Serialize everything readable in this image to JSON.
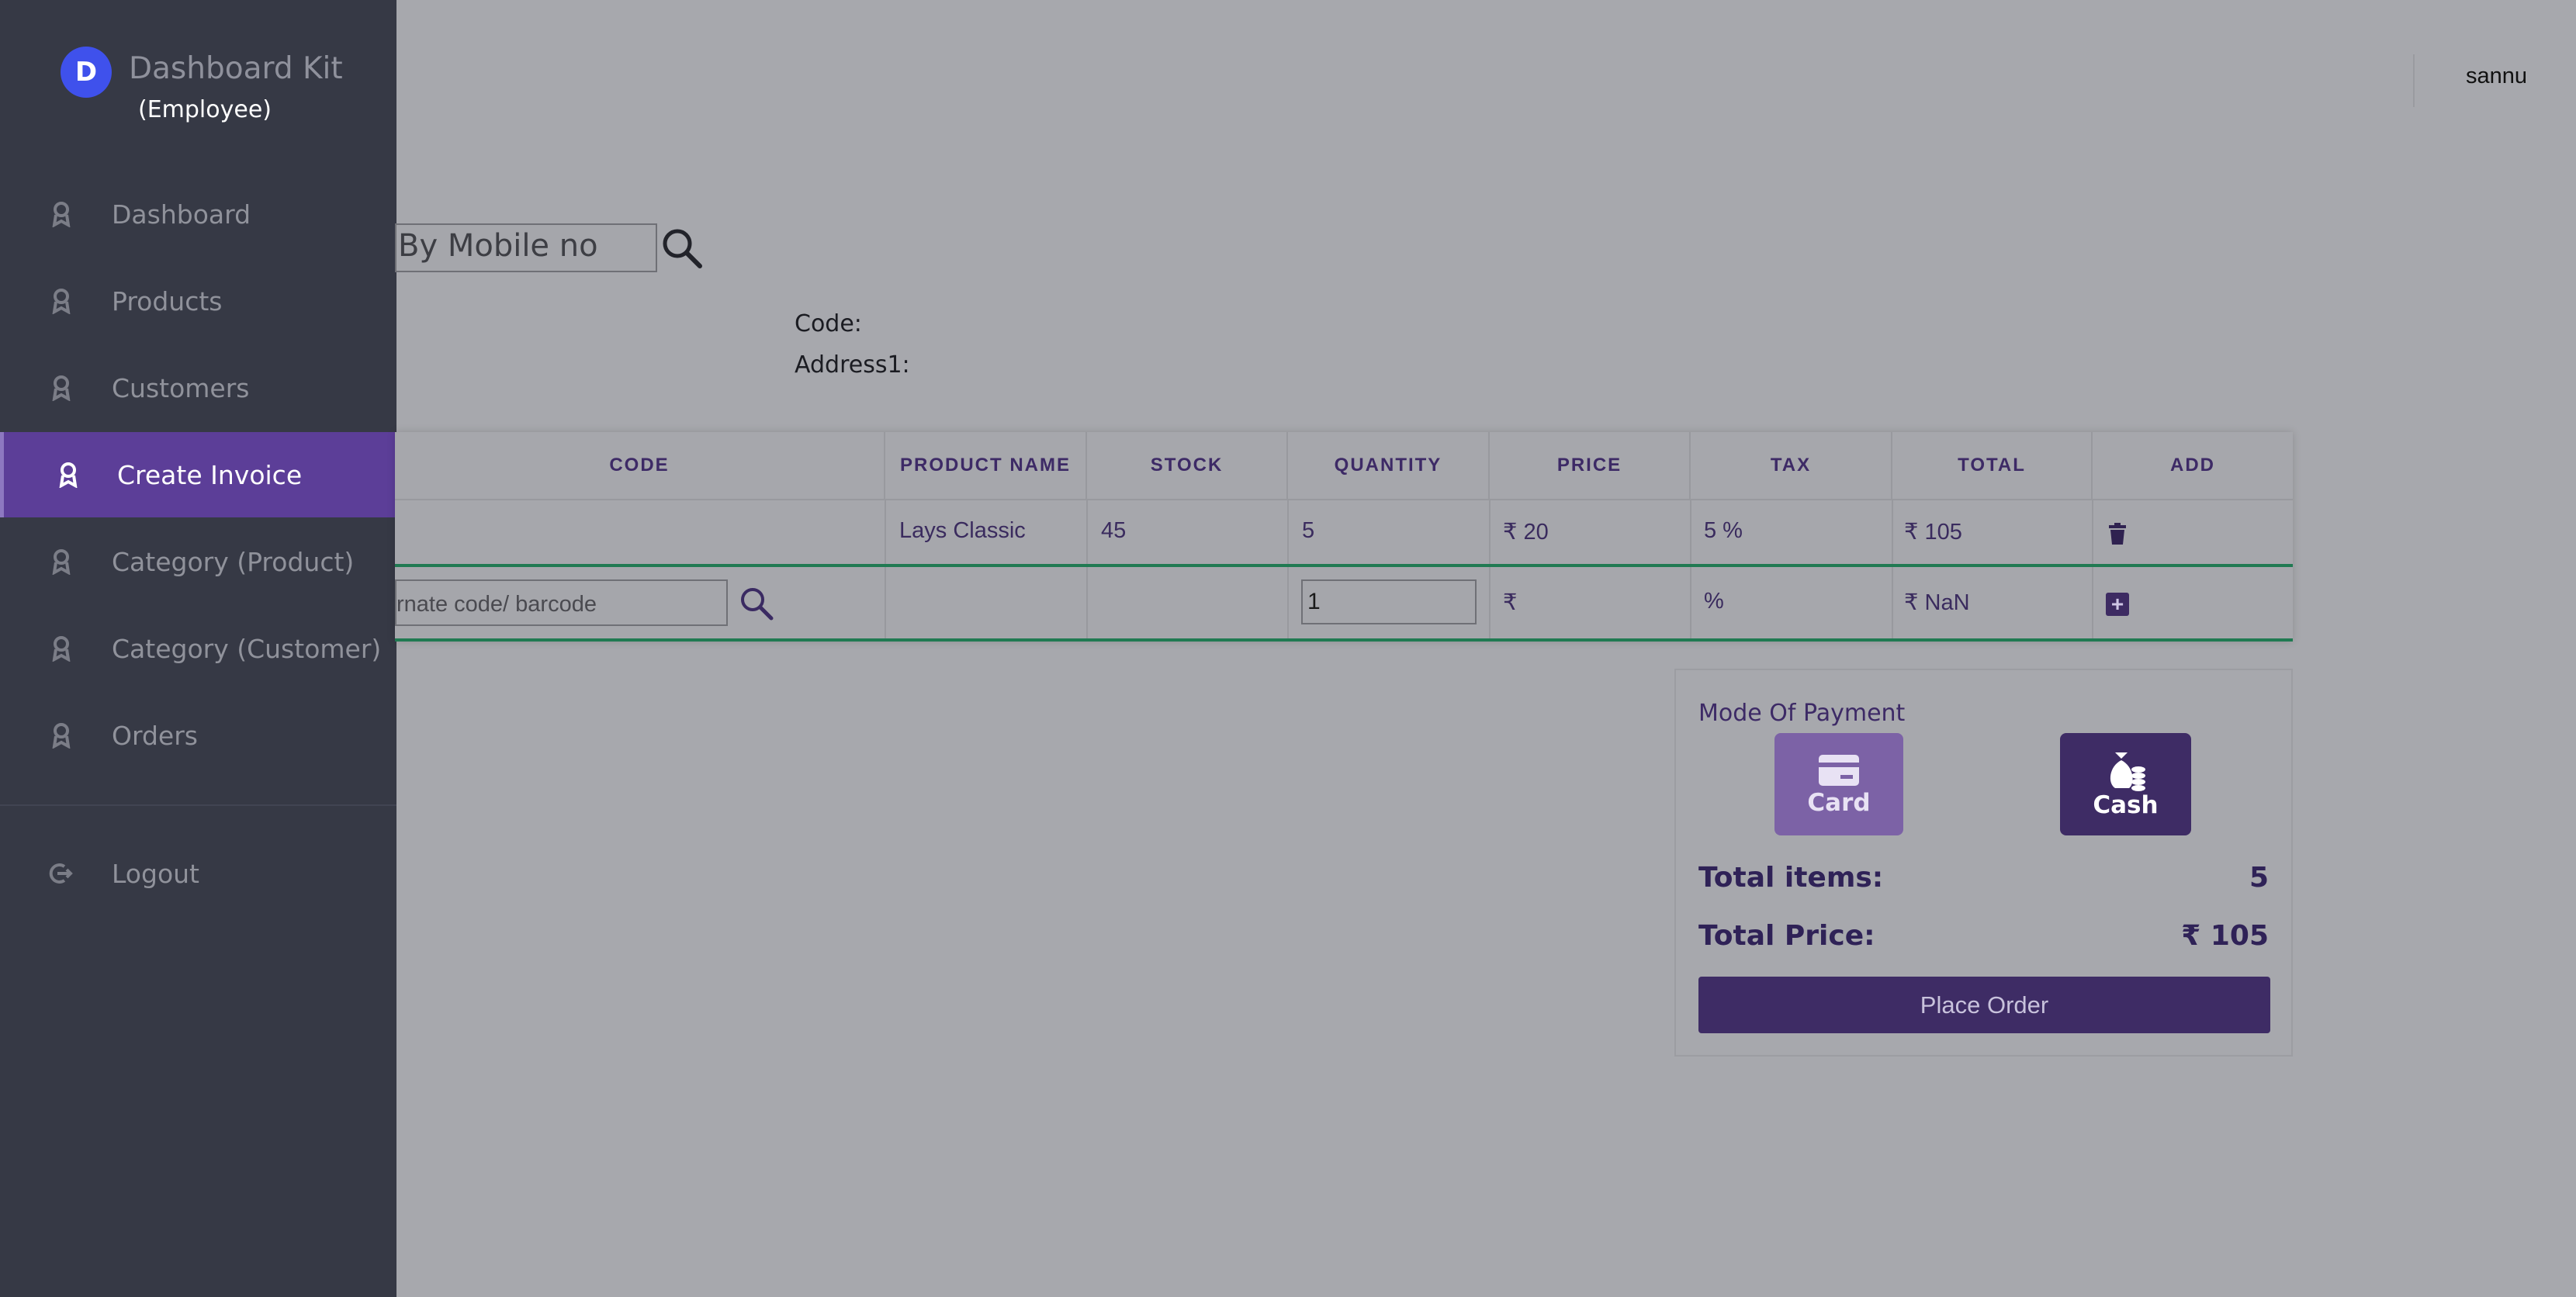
{
  "app": {
    "name": "Dashboard Kit",
    "logo_letter": "D",
    "role": "(Employee)"
  },
  "sidebar": {
    "items": [
      {
        "label": "Dashboard",
        "active": false
      },
      {
        "label": "Products",
        "active": false
      },
      {
        "label": "Customers",
        "active": false
      },
      {
        "label": "Create Invoice",
        "active": true
      },
      {
        "label": "Category (Product)",
        "active": false
      },
      {
        "label": "Category (Customer)",
        "active": false
      },
      {
        "label": "Orders",
        "active": false
      }
    ],
    "logout_label": "Logout"
  },
  "header": {
    "user": "sannu"
  },
  "customer_search": {
    "value": "By Mobile no",
    "code_label": "Code:",
    "address_label": "Address1:"
  },
  "table": {
    "headers": [
      "CODE",
      "PRODUCT NAME",
      "STOCK",
      "QUANTITY",
      "PRICE",
      "TAX",
      "TOTAL",
      "ADD"
    ],
    "rows": [
      {
        "code": "",
        "product_name": "Lays Classic",
        "stock": "45",
        "quantity": "5",
        "price": "₹ 20",
        "tax": "5 %",
        "total": "₹ 105"
      }
    ],
    "entry": {
      "code_value": "rnate code/ barcode",
      "quantity": "1",
      "price": "₹",
      "tax": "%",
      "total": "₹ NaN"
    }
  },
  "payment": {
    "title": "Mode Of Payment",
    "card_label": "Card",
    "cash_label": "Cash",
    "selected": "Cash",
    "total_items_label": "Total items:",
    "total_items_value": "5",
    "total_price_label": "Total Price:",
    "total_price_value": "₹ 105",
    "place_order_label": "Place Order"
  },
  "colors": {
    "sidebar_bg": "#363945",
    "active_item": "#5c3e98",
    "brand_logo": "#3f51ec",
    "accent_dark": "#3e2c65",
    "row_divider": "#207a52"
  }
}
